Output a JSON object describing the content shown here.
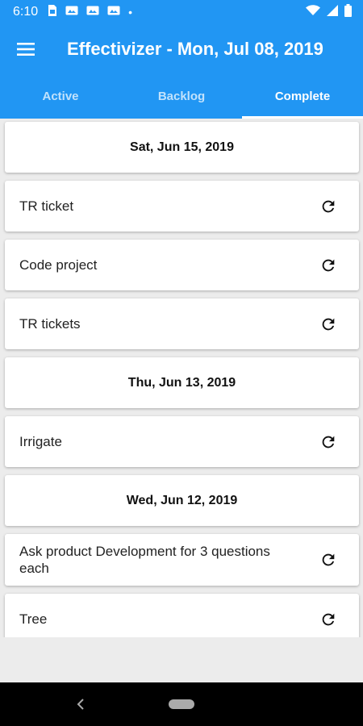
{
  "status_bar": {
    "time": "6:10",
    "dot": "•",
    "icons_left": [
      "sim-icon",
      "photo-icon",
      "photo-icon",
      "photo-icon"
    ],
    "icons_right": [
      "wifi-icon",
      "signal-icon",
      "battery-icon"
    ]
  },
  "app_bar": {
    "title": "Effectivizer - Mon, Jul 08, 2019",
    "menu_icon": "hamburger-menu-icon"
  },
  "tabs": [
    {
      "label": "Active",
      "active": false
    },
    {
      "label": "Backlog",
      "active": false
    },
    {
      "label": "Complete",
      "active": true
    }
  ],
  "groups": [
    {
      "date": "Sat, Jun 15, 2019",
      "tasks": [
        {
          "text": "TR ticket"
        },
        {
          "text": "Code project"
        },
        {
          "text": "TR tickets"
        }
      ]
    },
    {
      "date": "Thu, Jun 13, 2019",
      "tasks": [
        {
          "text": "Irrigate"
        }
      ]
    },
    {
      "date": "Wed, Jun 12, 2019",
      "tasks": [
        {
          "text": "Ask product Development for 3 questions each"
        },
        {
          "text": "Tree"
        }
      ]
    }
  ],
  "colors": {
    "primary": "#2196f3",
    "background": "#ececec",
    "card": "#ffffff"
  }
}
